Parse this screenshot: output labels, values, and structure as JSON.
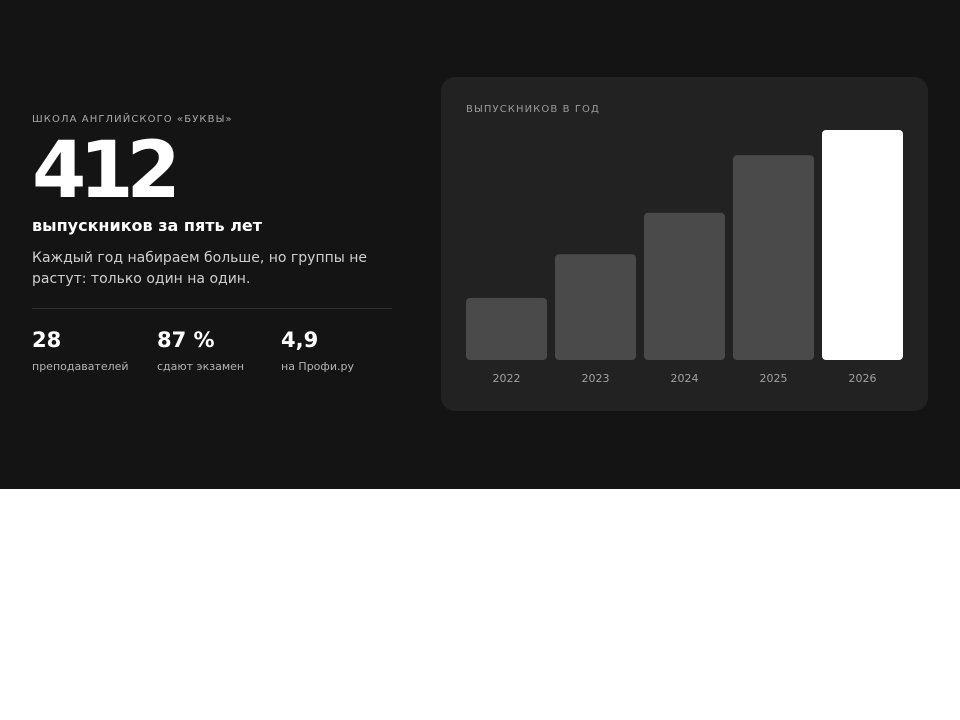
{
  "hero": {
    "eyebrow": "ШКОЛА АНГЛИЙСКОГО «БУКВЫ»",
    "big_number": "412",
    "headline": "выпускников за пять лет",
    "description": "Каждый год набираем больше, но группы не растут: только один на один.",
    "stats": [
      {
        "value": "28",
        "label": "преподавателей"
      },
      {
        "value": "87 %",
        "label": "сдают экзамен"
      },
      {
        "value": "4,9",
        "label": "на Профи.ру"
      }
    ]
  },
  "colors": {
    "background": "#141414",
    "card": "#222222",
    "bar": "#4a4a4a",
    "bar_highlight": "#ffffff"
  },
  "chart_data": {
    "type": "bar",
    "title": "ВЫПУСКНИКОВ В ГОД",
    "categories": [
      "2022",
      "2023",
      "2024",
      "2025",
      "2026"
    ],
    "values": [
      27,
      46,
      64,
      89,
      100
    ],
    "highlight_index": 4,
    "ylim": [
      0,
      100
    ],
    "grid": false,
    "xlabel": "",
    "ylabel": ""
  }
}
